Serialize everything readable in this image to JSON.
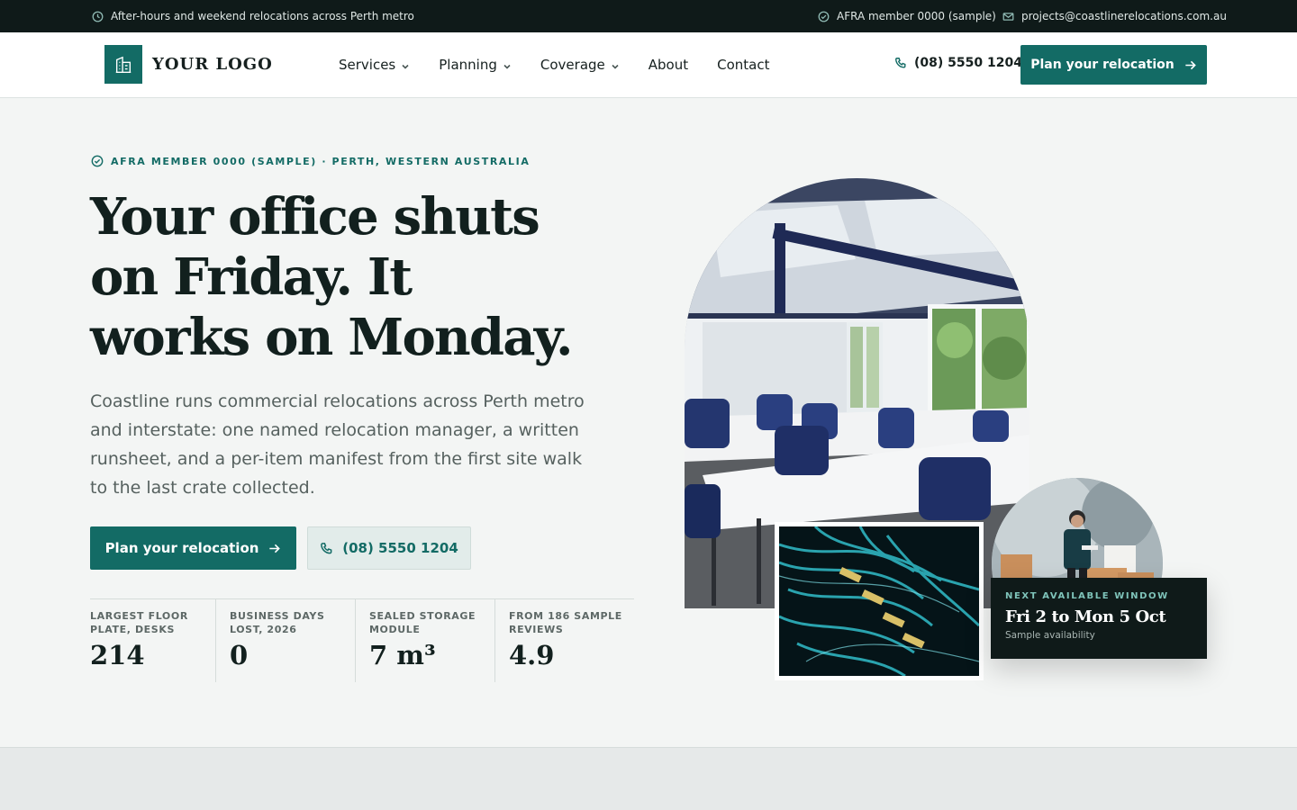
{
  "topbar": {
    "hours_text": "After-hours and weekend relocations across Perth metro",
    "membership_text": "AFRA member 0000 (sample)",
    "email": "projects@coastlinerelocations.com.au"
  },
  "header": {
    "logo_text": "YOUR LOGO",
    "nav": [
      {
        "label": "Services",
        "has_dropdown": true
      },
      {
        "label": "Planning",
        "has_dropdown": true
      },
      {
        "label": "Coverage",
        "has_dropdown": true
      },
      {
        "label": "About",
        "has_dropdown": false
      },
      {
        "label": "Contact",
        "has_dropdown": false
      }
    ],
    "phone": "(08) 5550 1204",
    "cta_label": "Plan your relocation"
  },
  "hero": {
    "eyebrow": "AFRA MEMBER 0000 (SAMPLE) · PERTH, WESTERN AUSTRALIA",
    "headline_lines": [
      "Your office shuts",
      "on Friday. It",
      "works on Monday."
    ],
    "lead": "Coastline runs commercial relocations across Perth metro and interstate: one named relocation manager, a written runsheet, and a per-item manifest from the first site walk to the last crate collected.",
    "primary_cta": "Plan your relocation",
    "secondary_cta": "(08) 5550 1204",
    "stats": [
      {
        "label": "Largest floor plate, desks",
        "value": "214"
      },
      {
        "label": "Business days lost, 2026",
        "value": "0"
      },
      {
        "label": "Sealed storage module",
        "value": "7 m³"
      },
      {
        "label": "From 186 sample reviews",
        "value": "4.9"
      }
    ]
  },
  "availability": {
    "label": "NEXT AVAILABLE WINDOW",
    "title": "Fri 2 to Mon 5 Oct",
    "note": "Sample availability"
  },
  "colors": {
    "brand": "#136b65",
    "dark": "#0f1a19",
    "background": "#f3f5f4",
    "accent_text": "#7fc4ba"
  }
}
